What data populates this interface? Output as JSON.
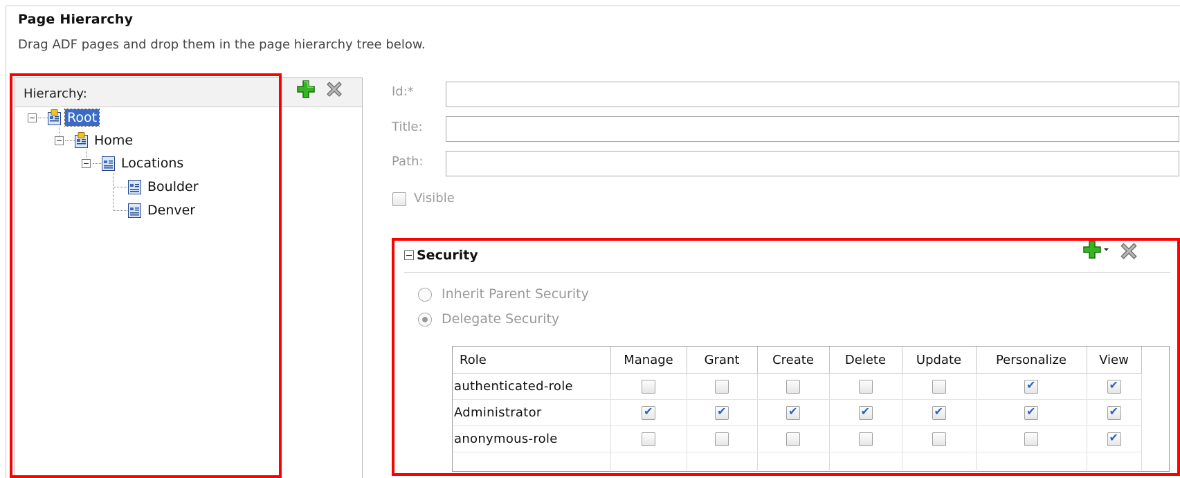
{
  "header": {
    "title": "Page Hierarchy",
    "description": "Drag ADF pages and drop them in the page hierarchy tree below."
  },
  "hierarchy": {
    "label": "Hierarchy:",
    "add_icon": "green-plus-icon",
    "delete_icon": "gray-x-icon",
    "tree": [
      {
        "label": "Root",
        "level": 0,
        "selected": true
      },
      {
        "label": "Home",
        "level": 1,
        "selected": false
      },
      {
        "label": "Locations",
        "level": 2,
        "selected": false
      },
      {
        "label": "Boulder",
        "level": 3,
        "selected": false
      },
      {
        "label": "Denver",
        "level": 3,
        "selected": false
      }
    ]
  },
  "form": {
    "id_label": "Id:*",
    "id_value": "",
    "title_label": "Title:",
    "title_value": "",
    "path_label": "Path:",
    "path_value": "",
    "visible_label": "Visible",
    "visible_checked": false
  },
  "security": {
    "title": "Security",
    "inherit_label": "Inherit Parent Security",
    "delegate_label": "Delegate Security",
    "selected_option": "delegate",
    "columns": [
      "Role",
      "Manage",
      "Grant",
      "Create",
      "Delete",
      "Update",
      "Personalize",
      "View"
    ],
    "rows": [
      {
        "role": "authenticated-role",
        "perms": [
          false,
          false,
          false,
          false,
          false,
          true,
          true
        ]
      },
      {
        "role": "Administrator",
        "perms": [
          true,
          true,
          true,
          true,
          true,
          true,
          true
        ]
      },
      {
        "role": "anonymous-role",
        "perms": [
          false,
          false,
          false,
          false,
          false,
          false,
          true
        ]
      }
    ]
  },
  "colors": {
    "highlight_box": "#ff0000",
    "selection": "#3b6bc4",
    "check_mark": "#2a5fc8",
    "add_icon": "#2fae1e"
  }
}
